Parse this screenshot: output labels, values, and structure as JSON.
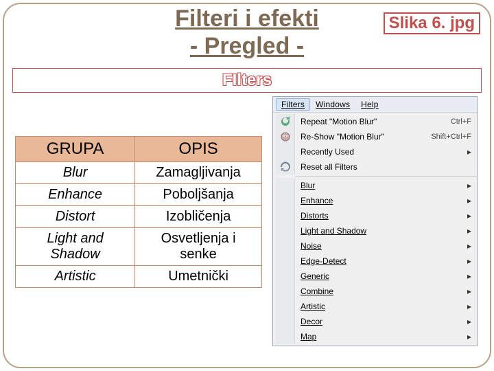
{
  "slide": {
    "title_line1": "Filteri i efekti",
    "title_line2": "- Pregled -",
    "image_tag": "Slika 6. jpg",
    "filters_heading": "FIlters"
  },
  "table": {
    "header_group": "GRUPA",
    "header_desc": "OPIS",
    "rows": [
      {
        "group": "Blur",
        "desc": "Zamagljivanja"
      },
      {
        "group": "Enhance",
        "desc": "Poboljšanja"
      },
      {
        "group": "Distort",
        "desc": "Izobličenja"
      },
      {
        "group": "Light and Shadow",
        "desc": "Osvetljenja i senke"
      },
      {
        "group": "Artistic",
        "desc": "Umetnički"
      }
    ]
  },
  "menu": {
    "bar": {
      "filters": "Filters",
      "windows": "Windows",
      "help": "Help"
    },
    "repeat": {
      "label": "Repeat \"Motion Blur\"",
      "key": "Ctrl+F"
    },
    "reshow": {
      "label": "Re-Show \"Motion Blur\"",
      "key": "Shift+Ctrl+F"
    },
    "recent": "Recently Used",
    "reset": "Reset all Filters",
    "groups": [
      "Blur",
      "Enhance",
      "Distorts",
      "Light and Shadow",
      "Noise",
      "Edge-Detect",
      "Generic",
      "Combine",
      "Artistic",
      "Decor",
      "Map"
    ]
  }
}
